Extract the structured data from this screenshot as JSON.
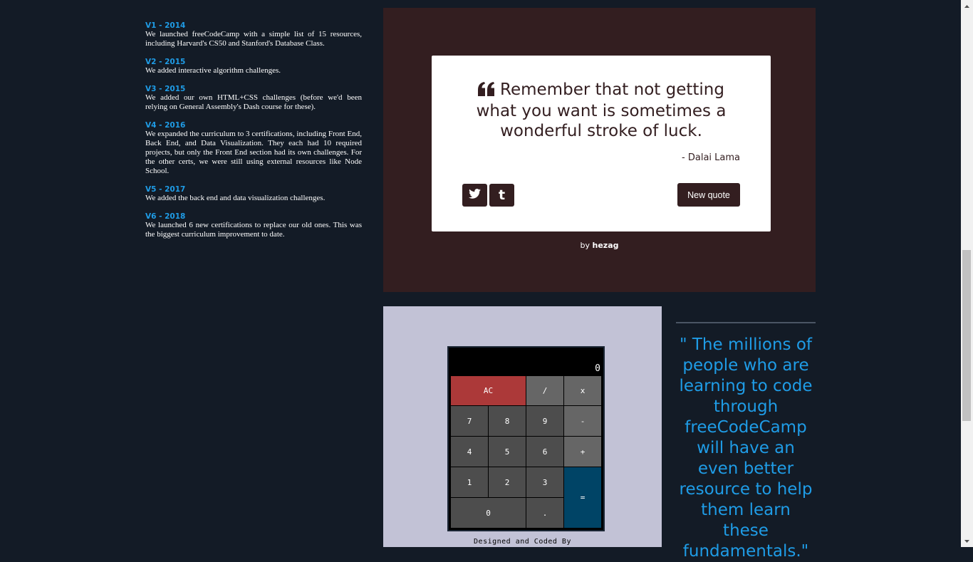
{
  "timeline": [
    {
      "title": "V1 - 2014",
      "text": "We launched freeCodeCamp with a simple list of 15 resources, including Harvard's CS50 and Stanford's Database Class."
    },
    {
      "title": "V2 - 2015",
      "text": "We added interactive algorithm challenges."
    },
    {
      "title": "V3 - 2015",
      "text": "We added our own HTML+CSS challenges (before we'd been relying on General Assembly's Dash course for these)."
    },
    {
      "title": "V4 - 2016",
      "text": "We expanded the curriculum to 3 certifications, including Front End, Back End, and Data Visualization. They each had 10 required projects, but only the Front End section had its own challenges. For the other certs, we were still using external resources like Node School."
    },
    {
      "title": "V5 - 2017",
      "text": "We added the back end and data visualization challenges."
    },
    {
      "title": "V6 - 2018",
      "text": "We launched 6 new certifications to replace our old ones. This was the biggest curriculum improvement to date."
    }
  ],
  "quote_machine": {
    "quote": "Remember that not getting what you want is sometimes a wonderful stroke of luck.",
    "author": "- Dalai Lama",
    "quote_icon": "quote-left-icon",
    "twitter_icon": "twitter-icon",
    "tumblr_icon": "tumblr-icon",
    "tumblr_glyph": "t",
    "new_quote_label": "New quote",
    "by_prefix": "by ",
    "by_name": "hezag",
    "accent_color": "#331e20"
  },
  "calculator": {
    "formula": "",
    "display": "0",
    "keys": {
      "clear": "AC",
      "divide": "/",
      "multiply": "x",
      "seven": "7",
      "eight": "8",
      "nine": "9",
      "subtract": "-",
      "four": "4",
      "five": "5",
      "six": "6",
      "add": "+",
      "one": "1",
      "two": "2",
      "three": "3",
      "equals": "=",
      "zero": "0",
      "decimal": "."
    },
    "footer": "Designed and Coded By",
    "colors": {
      "clear": "#ac3939",
      "equals": "#004466",
      "operator": "#666666",
      "digit": "#4d4d4d"
    }
  },
  "big_quote": {
    "text": "\" The millions of people who are learning to code through freeCodeCamp will have an even better resource to help them learn these fundamentals.\"",
    "color": "#1f9ce6"
  }
}
